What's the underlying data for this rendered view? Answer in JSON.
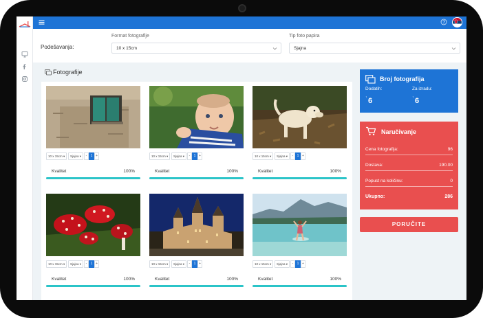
{
  "colors": {
    "topbar": "#1e74d6",
    "count_card": "#1e74d6",
    "order_card": "#e94f4f",
    "quality_bar": "#2bc4c8"
  },
  "icons": {
    "menu": "menu-icon",
    "help": "help-icon",
    "rail": [
      "monitor-icon",
      "facebook-icon",
      "instagram-icon"
    ],
    "section": "photos-icon",
    "count": "photo-stack-icon",
    "order": "cart-icon"
  },
  "settings": {
    "label": "Podešavanja:",
    "format_label": "Format fotografije",
    "format_value": "10 x 15cm",
    "paper_label": "Tip foto papira",
    "paper_value": "Sjajna"
  },
  "section": {
    "title": "Fotografije"
  },
  "photos": [
    {
      "subject": "wall-window",
      "format": "10 x 15cm",
      "paper": "Sjajna",
      "minus": "-",
      "qty": "1",
      "plus": "+",
      "quality_label": "Kvalitet",
      "quality": "100%",
      "quality_value": 1.0
    },
    {
      "subject": "baby",
      "format": "10 x 15cm",
      "paper": "Sjajna",
      "minus": "-",
      "qty": "1",
      "plus": "+",
      "quality_label": "Kvalitet",
      "quality": "100%",
      "quality_value": 1.0
    },
    {
      "subject": "dog",
      "format": "10 x 15cm",
      "paper": "Sjajna",
      "minus": "-",
      "qty": "1",
      "plus": "+",
      "quality_label": "Kvalitet",
      "quality": "100%",
      "quality_value": 1.0
    },
    {
      "subject": "mushrooms",
      "format": "10 x 15cm",
      "paper": "Sjajna",
      "minus": "-",
      "qty": "1",
      "plus": "+",
      "quality_label": "Kvalitet",
      "quality": "100%",
      "quality_value": 1.0
    },
    {
      "subject": "castle",
      "format": "10 x 15cm",
      "paper": "Sjajna",
      "minus": "-",
      "qty": "1",
      "plus": "+",
      "quality_label": "Kvalitet",
      "quality": "100%",
      "quality_value": 1.0
    },
    {
      "subject": "lake",
      "format": "10 x 15cm",
      "paper": "Sjajna",
      "minus": "-",
      "qty": "1",
      "plus": "+",
      "quality_label": "Kvalitet",
      "quality": "100%",
      "quality_value": 1.0
    }
  ],
  "count_card": {
    "title": "Broj fotografija",
    "added_label": "Dodatih:",
    "added_value": "6",
    "to_print_label": "Za izradu:",
    "to_print_value": "6"
  },
  "order_card": {
    "title": "Naručivanje",
    "rows": [
      {
        "label": "Cena fotografija:",
        "value": "96"
      },
      {
        "label": "Dostava:",
        "value": "190.00"
      },
      {
        "label": "Popust na količinu:",
        "value": "0"
      },
      {
        "label": "Ukupno:",
        "value": "286"
      }
    ],
    "button": "PORUČITE"
  }
}
